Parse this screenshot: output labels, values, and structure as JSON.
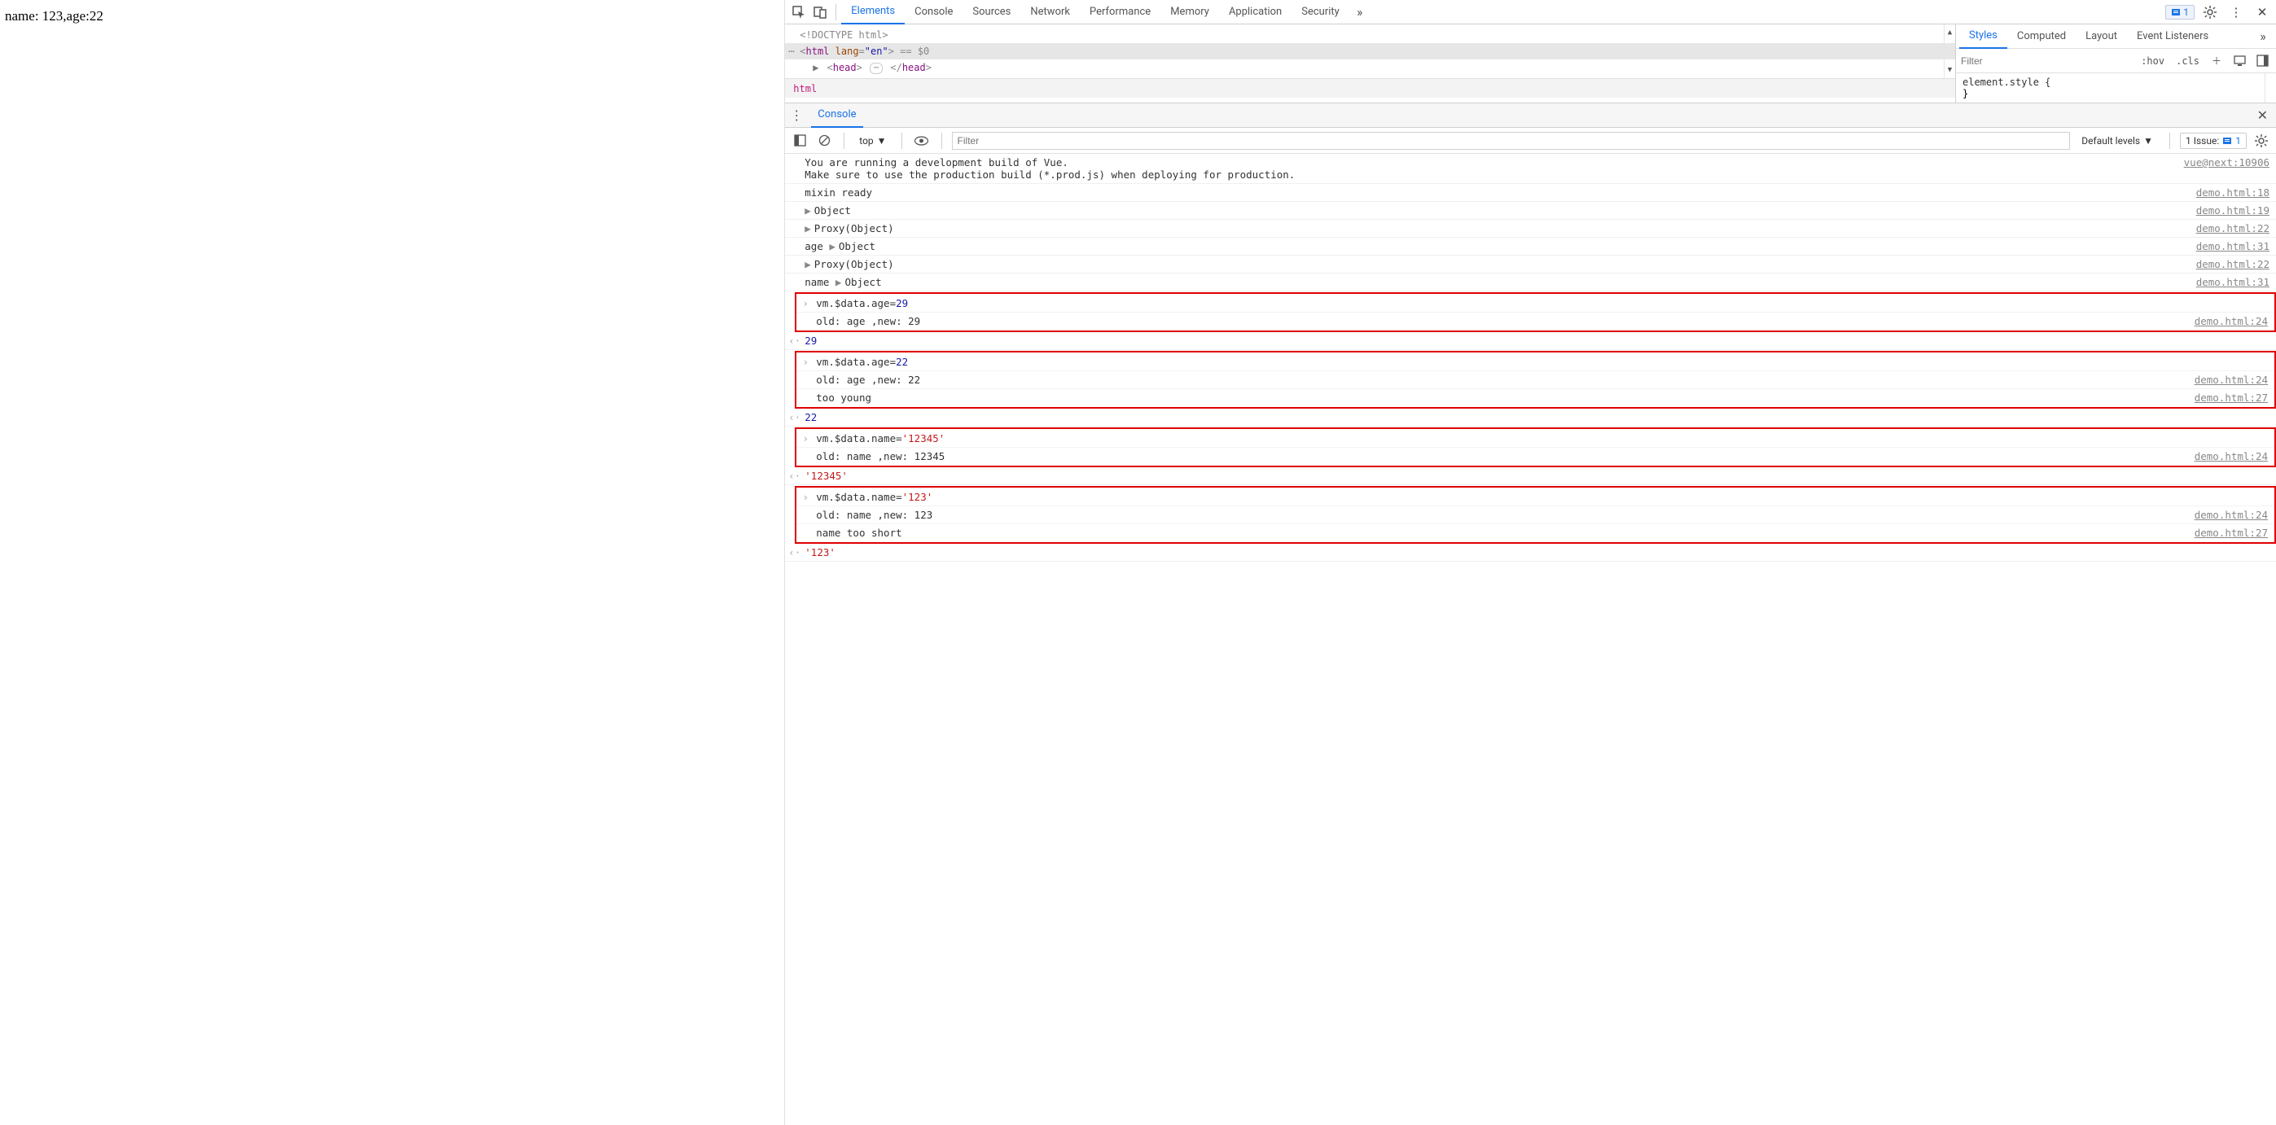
{
  "page": {
    "content": "name: 123,age:22"
  },
  "tabs": {
    "t0": "Elements",
    "t1": "Console",
    "t2": "Sources",
    "t3": "Network",
    "t4": "Performance",
    "t5": "Memory",
    "t6": "Application",
    "t7": "Security"
  },
  "toolbar": {
    "issue_count": "1"
  },
  "dom": {
    "l0": "<!DOCTYPE html>",
    "l1_open": "<",
    "l1_name": "html",
    "l1_attr": "lang",
    "l1_val": "\"en\"",
    "l1_close": ">",
    "l1_eq": " == $0",
    "l2_head_open": "<",
    "l2_head_name": "head",
    "l2_head_close": ">",
    "l2_head_end_open": "</",
    "l2_head_end_close": ">",
    "breadcrumb": "html"
  },
  "styles": {
    "tabs": {
      "t0": "Styles",
      "t1": "Computed",
      "t2": "Layout",
      "t3": "Event Listeners"
    },
    "filter_ph": "Filter",
    "hov": ":hov",
    "cls": ".cls",
    "rule": "element.style {",
    "brace": "}"
  },
  "console_hdr": {
    "label": "Console"
  },
  "console_tb": {
    "ctx": "top",
    "filter_ph": "Filter",
    "levels": "Default levels",
    "issues_label": "1 Issue:",
    "issues_n": "1"
  },
  "console": {
    "r0": {
      "msg": "You are running a development build of Vue.\nMake sure to use the production build (*.prod.js) when deploying for production.",
      "src": "vue@next:10906"
    },
    "r1": {
      "msg": "mixin ready",
      "src": "demo.html:18"
    },
    "r2": {
      "msg": "Object",
      "src": "demo.html:19"
    },
    "r3": {
      "msg": "Proxy(Object)",
      "src": "demo.html:22"
    },
    "r4": {
      "pre": "age ",
      "msg": "Object",
      "src": "demo.html:31"
    },
    "r5": {
      "msg": "Proxy(Object)",
      "src": "demo.html:22"
    },
    "r6": {
      "pre": "name ",
      "msg": "Object",
      "src": "demo.html:31"
    },
    "g1": {
      "in": {
        "a": "vm.$data.age=",
        "b": "29"
      },
      "out1": {
        "msg": "old: age ,new: 29",
        "src": "demo.html:24"
      }
    },
    "ret1": "29",
    "g2": {
      "in": {
        "a": "vm.$data.age=",
        "b": "22"
      },
      "out1": {
        "msg": "old: age ,new: 22",
        "src": "demo.html:24"
      },
      "out2": {
        "msg": "too young",
        "src": "demo.html:27"
      }
    },
    "ret2": "22",
    "g3": {
      "in": {
        "a": "vm.$data.name=",
        "b": "'12345'"
      },
      "out1": {
        "msg": "old: name ,new: 12345",
        "src": "demo.html:24"
      }
    },
    "ret3": "'12345'",
    "g4": {
      "in": {
        "a": "vm.$data.name=",
        "b": "'123'"
      },
      "out1": {
        "msg": "old: name ,new: 123",
        "src": "demo.html:24"
      },
      "out2": {
        "msg": "name too short",
        "src": "demo.html:27"
      }
    },
    "ret4": "'123'"
  }
}
